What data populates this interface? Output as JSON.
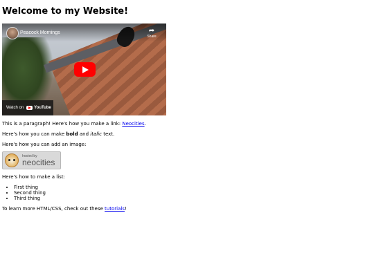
{
  "heading": "Welcome to my Website!",
  "video": {
    "title": "Peacock Mornings",
    "share_label": "Share",
    "watch_on": "Watch on",
    "youtube_brand": "YouTube"
  },
  "paragraph_link": {
    "before": "This is a paragraph! Here's how you make a link: ",
    "link_text": "Neocities",
    "after": "."
  },
  "paragraph_format": {
    "before": "Here's how you can make ",
    "bold": "bold",
    "middle": " and ",
    "italic": "italic",
    "after": " text."
  },
  "paragraph_image": "Here's how you can add an image:",
  "badge": {
    "small": "hosted by",
    "big": "neocities"
  },
  "paragraph_list": "Here's how to make a list:",
  "list_items": [
    "First thing",
    "Second thing",
    "Third thing"
  ],
  "paragraph_learn": {
    "before": "To learn more HTML/CSS, check out these ",
    "link_text": "tutorials",
    "after": "!"
  }
}
